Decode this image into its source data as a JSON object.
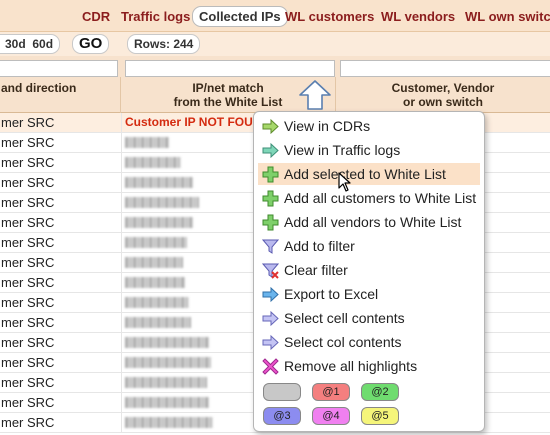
{
  "nav": {
    "tabs": [
      {
        "label": "CDR"
      },
      {
        "label": "Traffic logs"
      },
      {
        "label": "Collected IPs"
      },
      {
        "label": "WL customers"
      },
      {
        "label": "WL vendors"
      },
      {
        "label": "WL own switch"
      }
    ],
    "active_tab": "Collected IPs"
  },
  "toolbar": {
    "period_30d": "30d",
    "period_60d": "60d",
    "go_label": "GO",
    "rows_label": "Rows: 244"
  },
  "table": {
    "headers": {
      "direction": "and direction",
      "ip_match_line1": "IP/net match",
      "ip_match_line2": "from the White List",
      "owner_line1": "Customer, Vendor",
      "owner_line2": "or own switch"
    },
    "rows": [
      {
        "direction": "mer SRC",
        "ip_text": "Customer IP NOT FOUN"
      },
      {
        "direction": "mer SRC"
      },
      {
        "direction": "mer SRC"
      },
      {
        "direction": "mer SRC"
      },
      {
        "direction": "mer SRC"
      },
      {
        "direction": "mer SRC"
      },
      {
        "direction": "mer SRC"
      },
      {
        "direction": "mer SRC"
      },
      {
        "direction": "mer SRC"
      },
      {
        "direction": "mer SRC"
      },
      {
        "direction": "mer SRC"
      },
      {
        "direction": "mer SRC"
      },
      {
        "direction": "mer SRC"
      },
      {
        "direction": "mer SRC"
      },
      {
        "direction": "mer SRC"
      },
      {
        "direction": "mer SRC"
      }
    ]
  },
  "context_menu": {
    "items": [
      {
        "label": "View in CDRs",
        "icon": "arrow-right-green-icon"
      },
      {
        "label": "View in Traffic logs",
        "icon": "arrow-right-teal-icon"
      },
      {
        "label": "Add selected to White List",
        "icon": "plus-green-icon"
      },
      {
        "label": "Add all customers to White List",
        "icon": "plus-green-icon"
      },
      {
        "label": "Add all vendors to White List",
        "icon": "plus-green-icon"
      },
      {
        "label": "Add to filter",
        "icon": "filter-icon"
      },
      {
        "label": "Clear filter",
        "icon": "filter-clear-icon"
      },
      {
        "label": "Export to Excel",
        "icon": "arrow-right-blue-icon"
      },
      {
        "label": "Select cell contents",
        "icon": "arrow-right-lavender-icon"
      },
      {
        "label": "Select col contents",
        "icon": "arrow-right-lavender-icon"
      },
      {
        "label": "Remove all highlights",
        "icon": "x-magenta-icon"
      }
    ],
    "hovered_item": "Add selected to White List",
    "highlight_chips": [
      {
        "label": "",
        "color": "#c8c8c8"
      },
      {
        "label": "@1",
        "color": "#f47f7f"
      },
      {
        "label": "@2",
        "color": "#6fdc6f"
      },
      {
        "label": "@3",
        "color": "#8c8cf0"
      },
      {
        "label": "@4",
        "color": "#f080f0"
      },
      {
        "label": "@5",
        "color": "#f5f57a"
      }
    ]
  },
  "colors": {
    "nav_bg": "#f9e3cc",
    "tab_text": "#8b1d1d",
    "not_found": "#d42b10",
    "menu_hover": "#fbe1c8"
  }
}
